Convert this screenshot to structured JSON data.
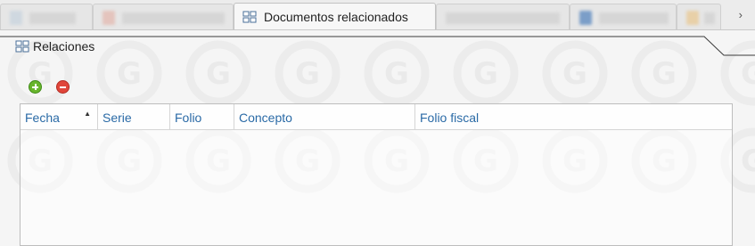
{
  "tabs": [
    {
      "label": "",
      "blurred": true
    },
    {
      "label": "",
      "blurred": true
    },
    {
      "label": "Documentos relacionados",
      "active": true,
      "icon": "related-documents-icon"
    },
    {
      "label": "",
      "blurred": true
    },
    {
      "label": "",
      "blurred": true
    },
    {
      "label": "",
      "blurred": true
    }
  ],
  "tab_scroll_icon": "chevron-right-icon",
  "panel": {
    "title": "Relaciones",
    "icon": "related-documents-icon"
  },
  "toolbar": {
    "add_icon": "add-icon",
    "remove_icon": "remove-icon"
  },
  "grid": {
    "columns": [
      "Fecha",
      "Serie",
      "Folio",
      "Concepto",
      "Folio fiscal"
    ],
    "sort_column": "Fecha",
    "sort_direction": "ascending",
    "rows": []
  },
  "colors": {
    "column_header_text": "#2a6aa6",
    "add_button": "#68b52c",
    "remove_button": "#e0453a"
  }
}
